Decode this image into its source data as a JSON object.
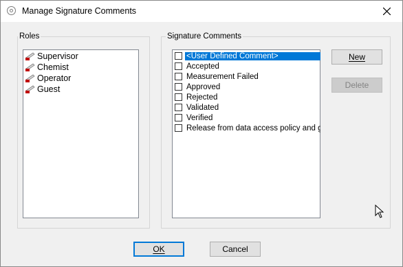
{
  "window": {
    "title": "Manage Signature Comments"
  },
  "roles": {
    "group_label": "Roles",
    "items": [
      "Supervisor",
      "Chemist",
      "Operator",
      "Guest"
    ]
  },
  "comments": {
    "group_label": "Signature Comments",
    "items": [
      "<User Defined Comment>",
      "Accepted",
      "Measurement Failed",
      "Approved",
      "Rejected",
      "Validated",
      "Verified",
      "Release from data access policy and gra"
    ],
    "new_label": "New",
    "delete_label": "Delete"
  },
  "footer": {
    "ok_label": "OK",
    "cancel_label": "Cancel"
  },
  "colors": {
    "selection": "#0078d7",
    "dialog_bg": "#f0f0f0"
  }
}
